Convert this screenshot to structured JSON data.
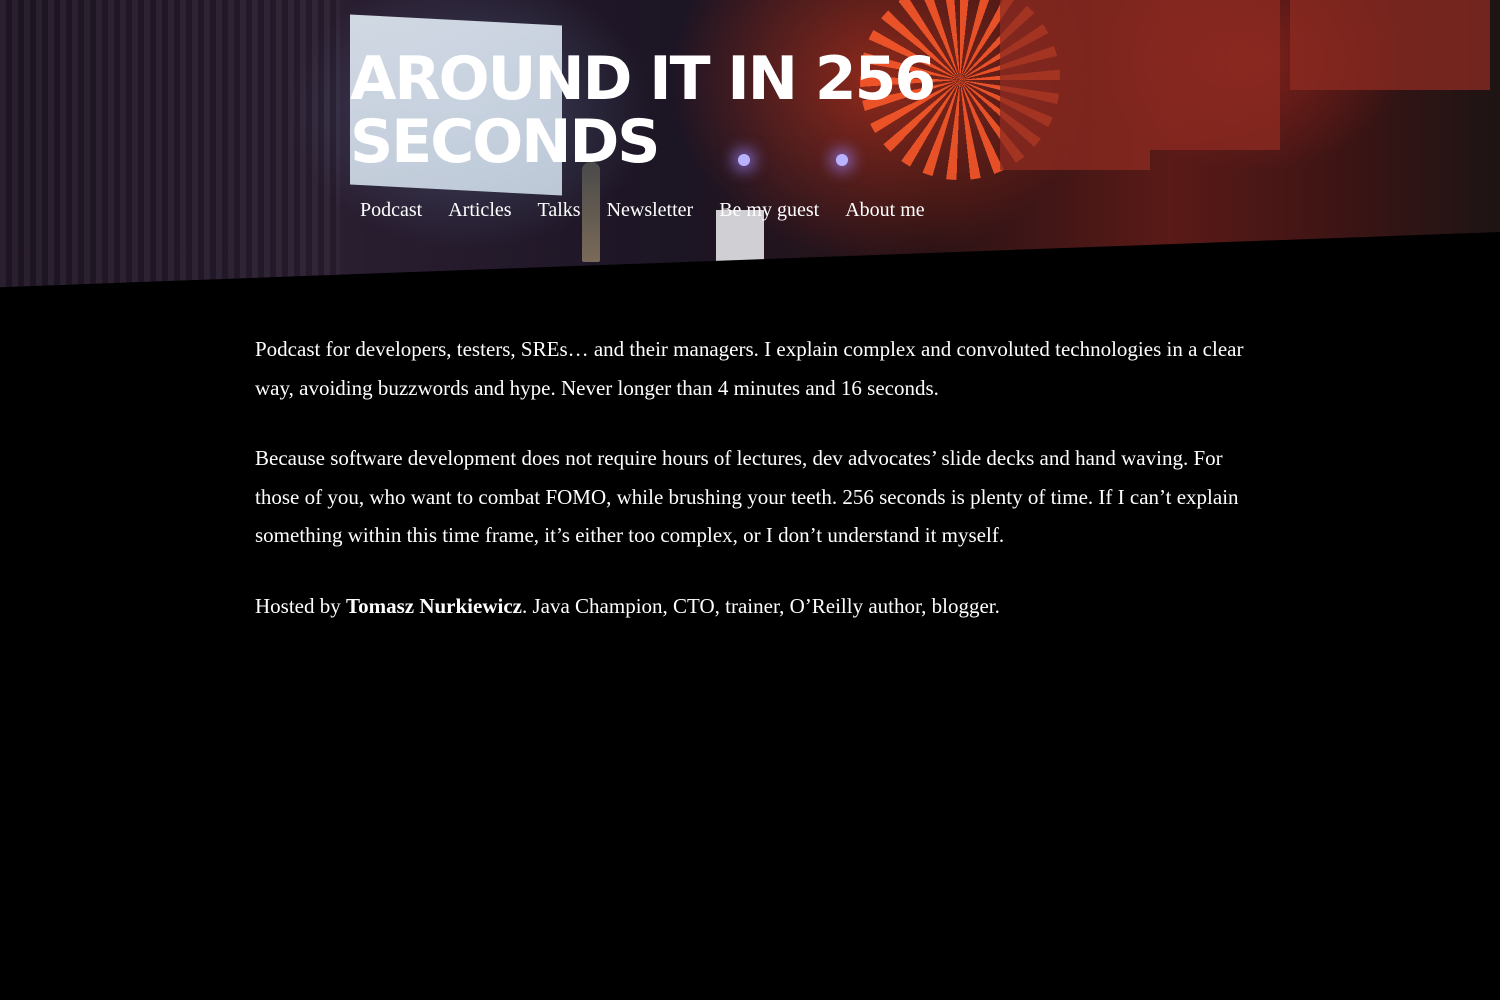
{
  "site": {
    "title": "AROUND IT IN 256 SECONDS"
  },
  "nav": {
    "items": [
      {
        "label": "Podcast"
      },
      {
        "label": "Articles"
      },
      {
        "label": "Talks"
      },
      {
        "label": "Newsletter"
      },
      {
        "label": "Be my guest"
      },
      {
        "label": "About me"
      }
    ]
  },
  "content": {
    "paragraph1": "Podcast for developers, testers, SREs… and their managers. I explain complex and convoluted technologies in a clear way, avoiding buzzwords and hype. Never longer than 4 minutes and 16 seconds.",
    "paragraph2": "Because software development does not require hours of lectures, dev advocates’ slide decks and hand waving. For those of you, who want to combat FOMO, while brushing your teeth. 256 seconds is plenty of time. If I can’t explain something within this time frame, it’s either too complex, or I don’t understand it myself.",
    "hosted_prefix": "Hosted by ",
    "host_name": "Tomasz Nurkiewicz",
    "host_suffix": ". Java Champion, CTO, trainer, O’Reilly author, blogger."
  },
  "colors": {
    "background": "#000000",
    "text": "#ffffff",
    "accent_red": "#ff5a2a"
  }
}
